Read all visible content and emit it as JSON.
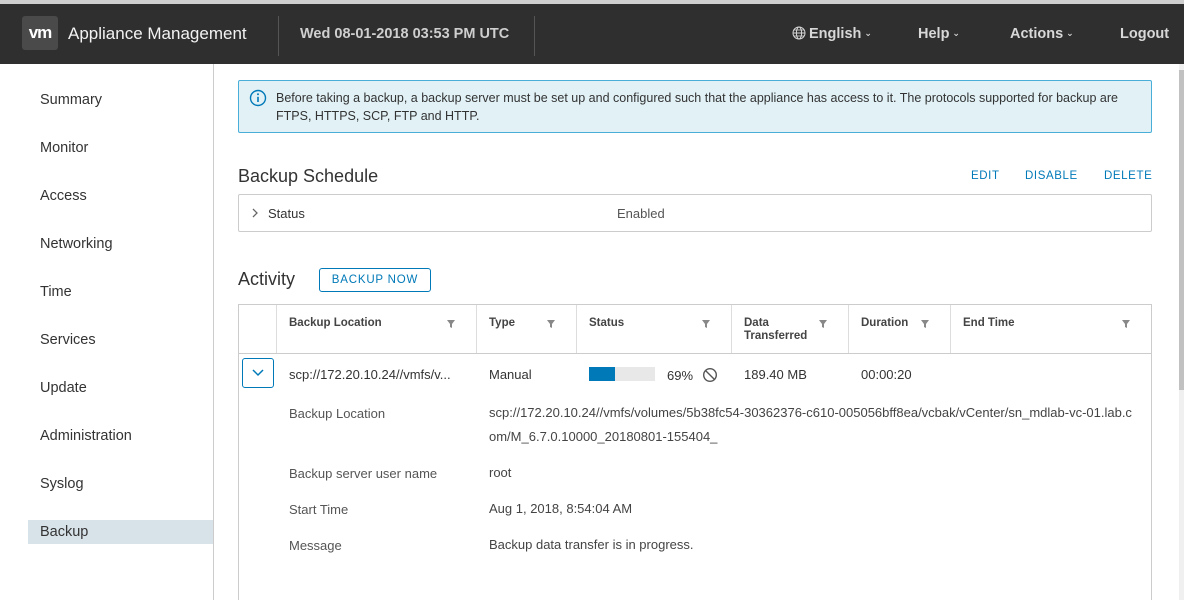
{
  "header": {
    "logo_text": "vm",
    "app_title": "Appliance Management",
    "datetime": "Wed 08-01-2018 03:53 PM UTC",
    "nav": {
      "language": "English",
      "help": "Help",
      "actions": "Actions",
      "logout": "Logout"
    }
  },
  "sidebar": {
    "items": [
      {
        "label": "Summary"
      },
      {
        "label": "Monitor"
      },
      {
        "label": "Access"
      },
      {
        "label": "Networking"
      },
      {
        "label": "Time"
      },
      {
        "label": "Services"
      },
      {
        "label": "Update"
      },
      {
        "label": "Administration"
      },
      {
        "label": "Syslog"
      },
      {
        "label": "Backup",
        "active": true
      }
    ]
  },
  "alert": {
    "text": "Before taking a backup, a backup server must be set up and configured such that the appliance has access to it. The protocols supported for backup are FTPS, HTTPS, SCP, FTP and HTTP."
  },
  "schedule": {
    "title": "Backup Schedule",
    "edit": "EDIT",
    "disable": "DISABLE",
    "delete": "DELETE",
    "status_label": "Status",
    "status_value": "Enabled"
  },
  "activity": {
    "title": "Activity",
    "backup_now": "BACKUP NOW",
    "columns": {
      "location": "Backup Location",
      "type": "Type",
      "status": "Status",
      "data_1": "Data",
      "data_2": "Transferred",
      "duration": "Duration",
      "end_time": "End Time"
    },
    "row": {
      "location": "scp://172.20.10.24//vmfs/v...",
      "type": "Manual",
      "progress_percent": 69,
      "progress_text": "69%",
      "data_transferred": "189.40 MB",
      "duration": "00:00:20",
      "end_time": ""
    },
    "details": {
      "location_label": "Backup Location",
      "location_value": "scp://172.20.10.24//vmfs/volumes/5b38fc54-30362376-c610-005056bff8ea/vcbak/vCenter/sn_mdlab-vc-01.lab.com/M_6.7.0.10000_20180801-155404_",
      "user_label": "Backup server user name",
      "user_value": "root",
      "start_label": "Start Time",
      "start_value": "Aug 1, 2018, 8:54:04 AM",
      "message_label": "Message",
      "message_value": "Backup data transfer is in progress."
    }
  },
  "colors": {
    "accent": "#0079b8",
    "header_bg": "#2f2f2f",
    "alert_bg": "#e1f1f6",
    "active_nav": "#d8e3e9"
  }
}
